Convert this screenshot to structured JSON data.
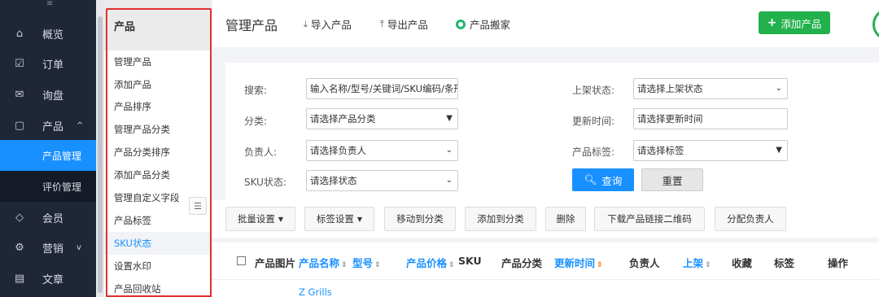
{
  "nav": {
    "top_glyph": "≡",
    "items": [
      {
        "icon": "home-icon",
        "glyph": "⌂",
        "label": "概览"
      },
      {
        "icon": "order-icon",
        "glyph": "☑",
        "label": "订单"
      },
      {
        "icon": "inquiry-icon",
        "glyph": "✉",
        "label": "询盘"
      },
      {
        "icon": "product-icon",
        "glyph": "▢",
        "label": "产品",
        "arrow": "^"
      },
      {
        "label": "产品管理"
      },
      {
        "label": "评价管理"
      },
      {
        "icon": "member-icon",
        "glyph": "◇",
        "label": "会员"
      },
      {
        "icon": "marketing-icon",
        "glyph": "⚙",
        "label": "营销",
        "arrow": "v"
      },
      {
        "icon": "article-icon",
        "glyph": "▤",
        "label": "文章"
      }
    ]
  },
  "sub": {
    "title": "产品",
    "items": [
      "管理产品",
      "添加产品",
      "产品排序",
      "管理产品分类",
      "产品分类排序",
      "添加产品分类",
      "管理自定义字段",
      "产品标签",
      "SKU状态",
      "设置水印",
      "产品回收站"
    ],
    "collapse_glyph": "☰"
  },
  "header": {
    "title": "管理产品",
    "import_label": "导入产品",
    "export_label": "导出产品",
    "move_label": "产品搬家",
    "add_label": "添加产品",
    "add_plus": "+"
  },
  "filter": {
    "search_label": "搜索:",
    "search_value": "输入名称/型号/关键词/SKU编码/条形",
    "category_label": "分类:",
    "category_value": "请选择产品分类",
    "owner_label": "负责人:",
    "owner_value": "请选择负责人",
    "sku_label": "SKU状态:",
    "sku_value": "请选择状态",
    "shelf_label": "上架状态:",
    "shelf_value": "请选择上架状态",
    "update_label": "更新时间:",
    "update_value": "请选择更新时间",
    "tag_label": "产品标签:",
    "tag_value": "请选择标签",
    "query_label": "查询",
    "reset_label": "重置"
  },
  "toolbar": {
    "buttons": [
      "批量设置",
      "标签设置",
      "移动到分类",
      "添加到分类",
      "删除",
      "下载产品链接二维码",
      "分配负责人"
    ]
  },
  "table": {
    "columns": [
      "产品图片",
      "产品名称",
      "型号",
      "产品价格",
      "SKU",
      "产品分类",
      "更新时间",
      "负责人",
      "上架",
      "收藏",
      "标签",
      "操作"
    ],
    "rows": [
      {
        "name": "Z Grills"
      }
    ]
  },
  "colors": {
    "nav_bg": "#1f2638",
    "active_blue": "#1890ff",
    "add_green": "#22b14c",
    "highlight_red": "#e03131"
  }
}
